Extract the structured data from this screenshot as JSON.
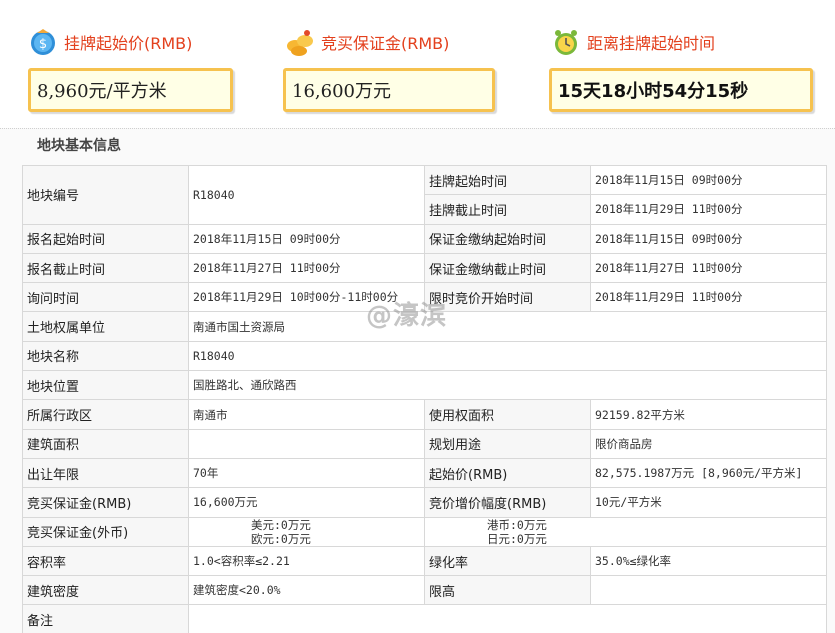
{
  "summary": {
    "start_price": {
      "title": "挂牌起始价(RMB)",
      "value": "8,960元/平方米",
      "icon": "money-bag-icon"
    },
    "deposit": {
      "title": "竞买保证金(RMB)",
      "value": "16,600万元",
      "icon": "coins-icon"
    },
    "countdown": {
      "title": "距离挂牌起始时间",
      "value": "15天18小时54分15秒",
      "icon": "alarm-clock-icon"
    }
  },
  "section": {
    "title": "地块基本信息"
  },
  "watermark": "@濠滨",
  "table": {
    "r1": {
      "l1": "地块编号",
      "v1": "R18040",
      "l2": "挂牌起始时间",
      "v2": "2018年11月15日 09时00分"
    },
    "r1b": {
      "l2": "挂牌截止时间",
      "v2": "2018年11月29日 11时00分"
    },
    "r2": {
      "l1": "报名起始时间",
      "v1": "2018年11月15日 09时00分",
      "l2": "保证金缴纳起始时间",
      "v2": "2018年11月15日 09时00分"
    },
    "r3": {
      "l1": "报名截止时间",
      "v1": "2018年11月27日 11时00分",
      "l2": "保证金缴纳截止时间",
      "v2": "2018年11月27日 11时00分"
    },
    "r4": {
      "l1": "询问时间",
      "v1": "2018年11月29日 10时00分-11时00分",
      "l2": "限时竞价开始时间",
      "v2": "2018年11月29日 11时00分"
    },
    "r5": {
      "l1": "土地权属单位",
      "v1": "南通市国土资源局"
    },
    "r6": {
      "l1": "地块名称",
      "v1": "R18040"
    },
    "r7": {
      "l1": "地块位置",
      "v1": "国胜路北、通欣路西"
    },
    "r8": {
      "l1": "所属行政区",
      "v1": "南通市",
      "l2": "使用权面积",
      "v2": "92159.82平方米"
    },
    "r9": {
      "l1": "建筑面积",
      "v1": "",
      "l2": "规划用途",
      "v2": "限价商品房"
    },
    "r10": {
      "l1": "出让年限",
      "v1": "70年",
      "l2": "起始价(RMB)",
      "v2": "82,575.1987万元 [8,960元/平方米]"
    },
    "r11": {
      "l1": "竞买保证金(RMB)",
      "v1": "16,600万元",
      "l2": "竞价增价幅度(RMB)",
      "v2": "10元/平方米"
    },
    "r12": {
      "l1": "竞买保证金(外币)",
      "usd": "美元:0万元",
      "eur": "欧元:0万元",
      "hkd": "港币:0万元",
      "jpy": "日元:0万元"
    },
    "r13": {
      "l1": "容积率",
      "v1": "1.0<容积率≤2.21",
      "l2": "绿化率",
      "v2": "35.0%≤绿化率"
    },
    "r14": {
      "l1": "建筑密度",
      "v1": "建筑密度<20.0%",
      "l2": "限高",
      "v2": ""
    },
    "r15": {
      "l1": "备注",
      "v1": ""
    }
  }
}
